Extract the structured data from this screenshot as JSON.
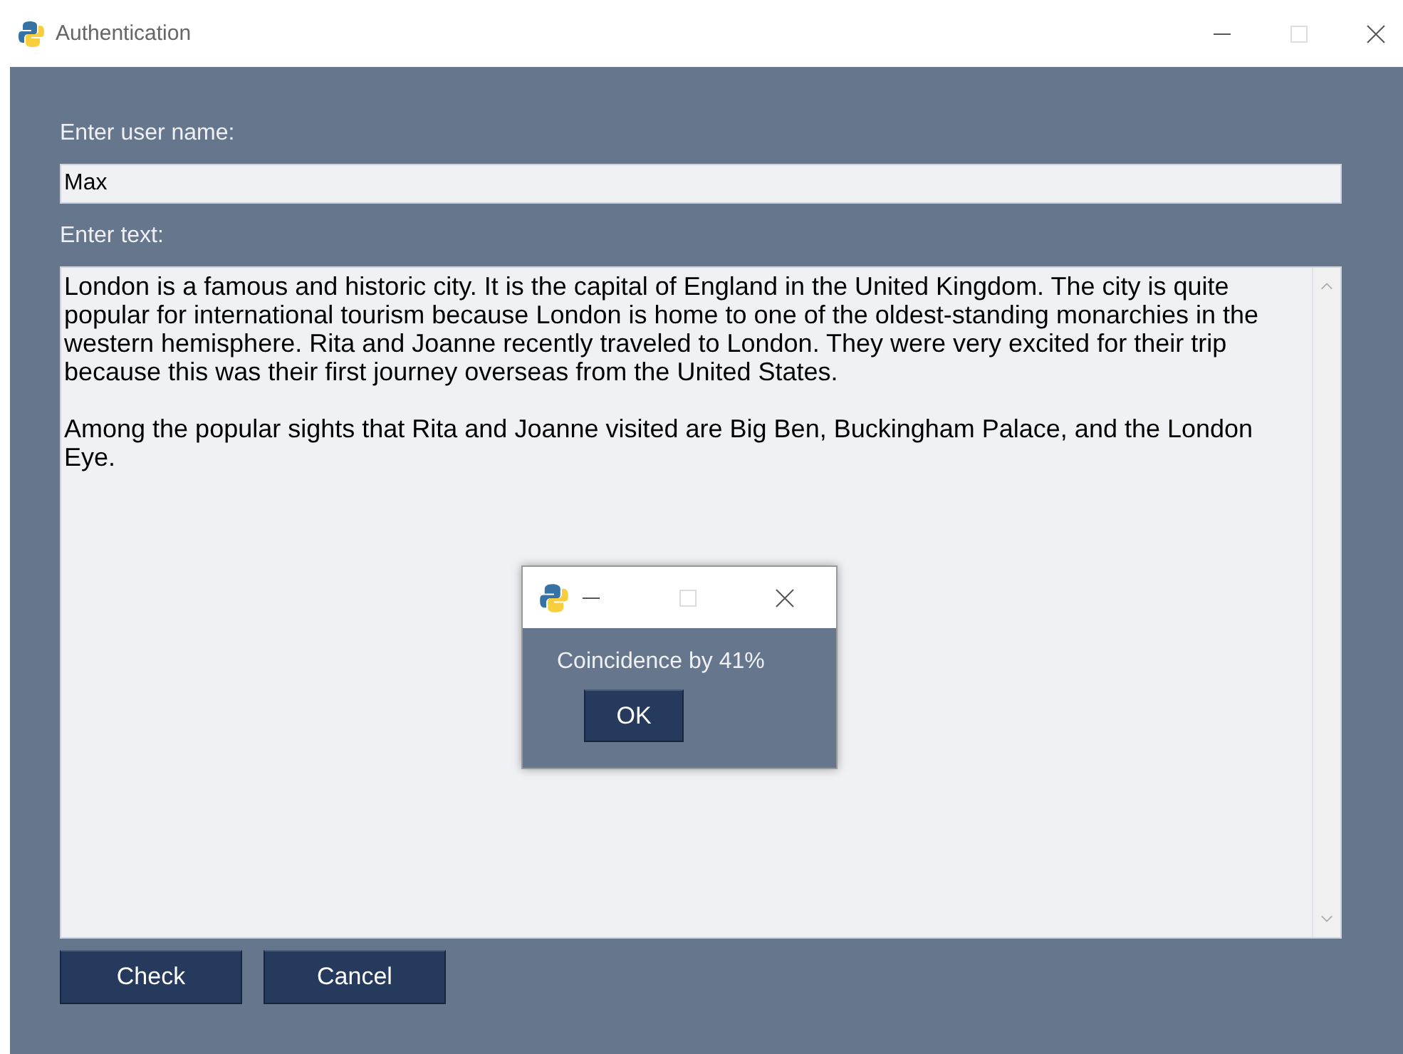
{
  "window": {
    "title": "Authentication"
  },
  "username": {
    "label": "Enter user name:",
    "value": "Max"
  },
  "text": {
    "label": "Enter text:",
    "paragraphs": [
      "London is a famous and historic city. It is the capital of England in the United Kingdom. The city is quite popular for international tourism because London is home to one of the oldest-standing monarchies in the western hemisphere. Rita and Joanne recently traveled to London. They were very excited for their trip because this was their first journey overseas from the United States.",
      "Among the popular sights that Rita and Joanne visited are Big Ben, Buckingham Palace, and the London Eye."
    ]
  },
  "buttons": [
    "Check",
    "Cancel"
  ],
  "dialog": {
    "message": "Coincidence by 41%",
    "button": "OK"
  }
}
